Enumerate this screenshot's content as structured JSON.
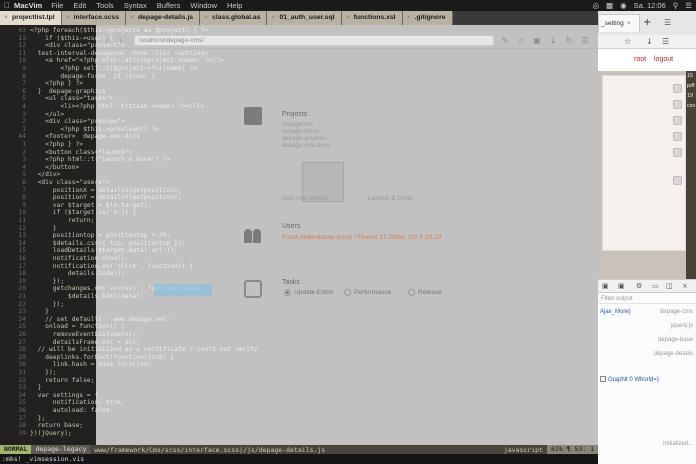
{
  "menubar": {
    "app_name": "MacVim",
    "menus": [
      "File",
      "Edit",
      "Tools",
      "Syntax",
      "Buffers",
      "Window",
      "Help"
    ],
    "clock": "Sa. 12:06"
  },
  "vim_tabs": [
    {
      "label": "projectlist.tpl",
      "active": true
    },
    {
      "label": "interface.scss",
      "active": false
    },
    {
      "label": "depage-details.js",
      "active": false
    },
    {
      "label": "class.global.as",
      "active": false
    },
    {
      "label": "01_auth_user.sql",
      "active": false
    },
    {
      "label": "functions.xsl",
      "active": false
    },
    {
      "label": ".gitignore",
      "active": false
    }
  ],
  "browser_ghost": {
    "url": "localhost/depage-cms/",
    "projects_title": "Projects",
    "project_list": [
      "depagecms",
      "depage-forms",
      "depage-graphics",
      "depage-cms-docs"
    ],
    "add_project": "Add new project",
    "launch_button": "Launch & Done",
    "users_title": "Users",
    "user_line": "Frank Hellenkamp (root) / Firefox 37.0/Mac OS X 10.10",
    "tasks_title": "Tasks",
    "tasks": [
      "Update Editor",
      "Performance",
      "Release"
    ]
  },
  "statusline": {
    "mode": "NORMAL",
    "branch": "depage-legacy",
    "path": "www/framework/Cms/scss/interface.scss|/js/depage-details.js",
    "filetype": "javascript",
    "position": "61% ¶ 53:  1"
  },
  "cmdline": ":mks! _vimsession.vis",
  "code_lines": [
    {
      "n": "43",
      "t": "<?php foreach($this->projects as $project) { ?>"
    },
    {
      "n": "13",
      "t": "    if ($this->user) {"
    },
    {
      "n": "12",
      "t": "    <div class=\"project\">"
    },
    {
      "n": "11",
      "t": "  test-interval-depagecms :home :list :settings"
    },
    {
      "n": "10",
      "t": "    <a href=\"<?php html::attr($project->name) ?>/\">"
    },
    {
      "n": "9",
      "t": "        <?php self::t($project->fullname) ?>"
    },
    {
      "n": "8",
      "t": "        depage-forms  if (true) {"
    },
    {
      "n": "7",
      "t": "    <?php } ?>"
    },
    {
      "n": "6",
      "t": "  }  depage-graphics"
    },
    {
      "n": "5",
      "t": "    <ul class=\"tasks\">"
    },
    {
      "n": "4",
      "t": "        <li><?php html::t($task->name) ?></li>"
    },
    {
      "n": "3",
      "t": "    </ul>"
    },
    {
      "n": "2",
      "t": "    <div class=\"preview\">"
    },
    {
      "n": "1",
      "t": "        <?php $this->previewUrl ?>"
    },
    {
      "n": "44",
      "t": "    <footer>  depage-cms-docs"
    },
    {
      "n": "1",
      "t": "    <?php } ?>"
    },
    {
      "n": "2",
      "t": "    <button class=\"launch\">"
    },
    {
      "n": "3",
      "t": "    <?php html::t(\"Launch & Done\") ?>"
    },
    {
      "n": "4",
      "t": "    </button>"
    },
    {
      "n": "5",
      "t": "  </div>"
    },
    {
      "n": "6",
      "t": "  <div class=\"users\">"
    },
    {
      "n": "7",
      "t": "      positionX = detailsX(getposition);"
    },
    {
      "n": "8",
      "t": "      positionY = detailsY(getposition);"
    },
    {
      "n": "9",
      "t": "      var $target = $(e.target);"
    },
    {
      "n": "10",
      "t": "      if ($target.is('a')) {"
    },
    {
      "n": "11",
      "t": "          return;"
    },
    {
      "n": "12",
      "t": "      }"
    },
    {
      "n": "13",
      "t": "      positiontop = positiontop + 20;"
    },
    {
      "n": "14",
      "t": "      $details.css({ top: positiontop });"
    },
    {
      "n": "15",
      "t": "      loadDetails($target.data('url'));"
    },
    {
      "n": "16",
      "t": "      notification.show();"
    },
    {
      "n": "17",
      "t": "      notification.on('click', function() {"
    },
    {
      "n": "18",
      "t": "          details.hide();"
    },
    {
      "n": "19",
      "t": "      });"
    },
    {
      "n": "20",
      "t": "      getchanges.on('success', function(data) {"
    },
    {
      "n": "21",
      "t": "          $details.html(data);"
    },
    {
      "n": "22",
      "t": "      });"
    },
    {
      "n": "23",
      "t": "    }"
    },
    {
      "n": "24",
      "t": "    // set defaults  'www.depage.net'"
    },
    {
      "n": "25",
      "t": "    onload = function() {"
    },
    {
      "n": "26",
      "t": "      removeEventListeners();"
    },
    {
      "n": "27",
      "t": "      detailsFrame.src = url;"
    },
    {
      "n": "28",
      "t": "  // will be initialized as a certificate / could not verify"
    },
    {
      "n": "29",
      "t": "    deeplinks.forEach(function(link) {"
    },
    {
      "n": "30",
      "t": "      link.hash = base.location;"
    },
    {
      "n": "31",
      "t": "    });"
    },
    {
      "n": "32",
      "t": "    return false;"
    },
    {
      "n": "33",
      "t": "  }"
    },
    {
      "n": "34",
      "t": "  var settings = {"
    },
    {
      "n": "35",
      "t": "      notification: true,"
    },
    {
      "n": "36",
      "t": "      autoload: false"
    },
    {
      "n": "37",
      "t": "  };"
    },
    {
      "n": "38",
      "t": "  return base;"
    },
    {
      "n": "39",
      "t": "})(jQuery);"
    }
  ],
  "right_browser": {
    "tab_title": "_setting",
    "nav_links": [
      "root",
      "logout"
    ],
    "strip_labels": [
      "15",
      "pdf",
      "19",
      "csv"
    ],
    "devtools_filter": "Filter output",
    "devtools_rows": [
      {
        "left": "Ajax_More)",
        "right": "depage-cms"
      },
      {
        "left": "",
        "right": "jquery.js"
      },
      {
        "left": "",
        "right": "depage-base"
      },
      {
        "left": "",
        "right": "depage-details"
      },
      {
        "left": "Graphit 0 Whorld=)",
        "right": ""
      },
      {
        "left": "",
        "right": "Initialized..."
      }
    ]
  }
}
